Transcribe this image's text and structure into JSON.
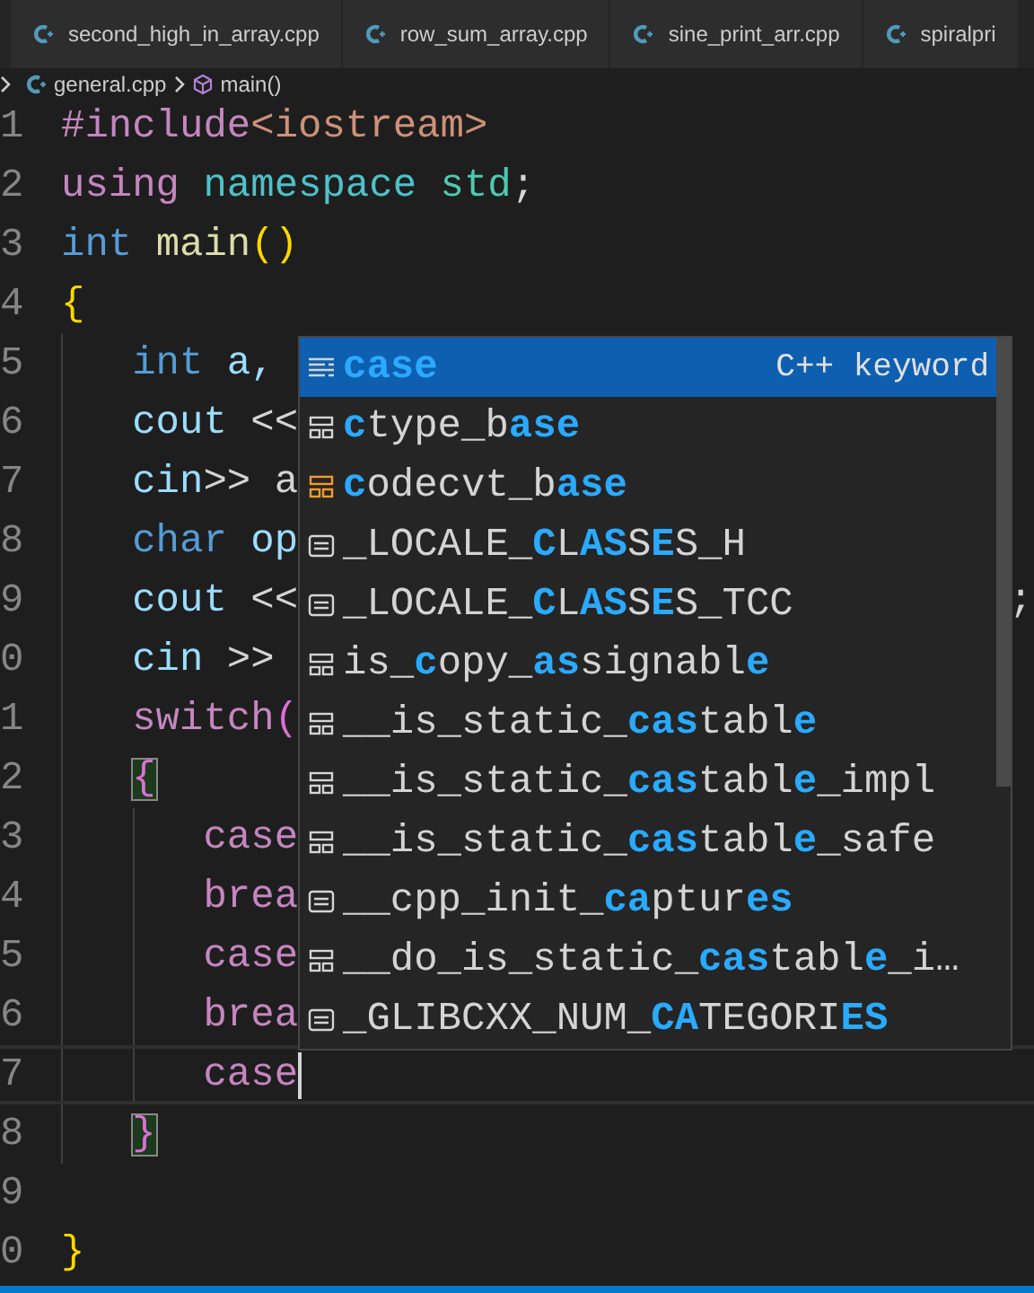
{
  "tabs": [
    {
      "label": "second_high_in_array.cpp",
      "selected": false
    },
    {
      "label": "row_sum_array.cpp",
      "selected": false
    },
    {
      "label": "sine_print_arr.cpp",
      "selected": false
    },
    {
      "label": "spiralpri",
      "selected": false
    }
  ],
  "breadcrumb": {
    "file": "general.cpp",
    "symbol": "main()"
  },
  "editor": {
    "lines": [
      {
        "number": "1",
        "tokens": [
          {
            "text": "#include",
            "color": "#c586c0"
          },
          {
            "text": "<iostream>",
            "color": "#ce9178"
          }
        ]
      },
      {
        "number": "2",
        "tokens": [
          {
            "text": "using",
            "color": "#c586c0"
          },
          {
            "text": " namespace",
            "color": "#4fc1c9"
          },
          {
            "text": " std",
            "color": "#4ec9b0"
          },
          {
            "text": ";",
            "color": "#d4d4d4"
          }
        ]
      },
      {
        "number": "3",
        "tokens": [
          {
            "text": "int",
            "color": "#569cd6"
          },
          {
            "text": " main",
            "color": "#dcdcaa"
          },
          {
            "text": "()",
            "color": "#ffd700"
          }
        ]
      },
      {
        "number": "4",
        "tokens": [
          {
            "text": "{",
            "color": "#ffd700"
          }
        ]
      },
      {
        "number": "5",
        "tokens": [
          {
            "text": "   int",
            "color": "#569cd6"
          },
          {
            "text": " a,",
            "color": "#9cdcfe"
          }
        ]
      },
      {
        "number": "6",
        "tokens": [
          {
            "text": "   cout",
            "color": "#9cdcfe"
          },
          {
            "text": " <<",
            "color": "#d4d4d4"
          }
        ]
      },
      {
        "number": "7",
        "tokens": [
          {
            "text": "   cin",
            "color": "#9cdcfe"
          },
          {
            "text": ">> a",
            "color": "#d4d4d4"
          }
        ]
      },
      {
        "number": "8",
        "tokens": [
          {
            "text": "   char",
            "color": "#569cd6"
          },
          {
            "text": " op",
            "color": "#9cdcfe"
          }
        ]
      },
      {
        "number": "9",
        "tokens": [
          {
            "text": "   cout",
            "color": "#9cdcfe"
          },
          {
            "text": " <<",
            "color": "#d4d4d4"
          },
          {
            "text": ";",
            "color": "#d4d4d4",
            "kind": "tail"
          }
        ]
      },
      {
        "number": "0",
        "tokens": [
          {
            "text": "   cin",
            "color": "#9cdcfe"
          },
          {
            "text": " >>",
            "color": "#d4d4d4"
          }
        ]
      },
      {
        "number": "1",
        "tokens": [
          {
            "text": "   switch",
            "color": "#c586c0"
          },
          {
            "text": "(",
            "color": "#da70d6"
          }
        ]
      },
      {
        "number": "2",
        "tokens": [
          {
            "text": "   {",
            "color": "#da70d6",
            "bracket_match": true
          }
        ]
      },
      {
        "number": "3",
        "tokens": [
          {
            "text": "      case",
            "color": "#c586c0"
          }
        ]
      },
      {
        "number": "4",
        "tokens": [
          {
            "text": "      brea",
            "color": "#c586c0"
          }
        ]
      },
      {
        "number": "5",
        "tokens": [
          {
            "text": "      case",
            "color": "#c586c0"
          }
        ]
      },
      {
        "number": "6",
        "tokens": [
          {
            "text": "      brea",
            "color": "#c586c0"
          }
        ]
      },
      {
        "number": "7",
        "current": true,
        "tokens": [
          {
            "text": "      case",
            "color": "#c586c0"
          }
        ]
      },
      {
        "number": "8",
        "tokens": [
          {
            "text": "   }",
            "color": "#da70d6",
            "bracket_match": true
          }
        ]
      },
      {
        "number": "9"
      },
      {
        "number": "0",
        "tokens": [
          {
            "text": "}",
            "color": "#ffd700"
          }
        ]
      }
    ]
  },
  "suggestions": [
    {
      "kind": "keyword",
      "selected": true,
      "detail": "C++ keyword",
      "label": "**case**"
    },
    {
      "kind": "struct",
      "selected": false,
      "label": "**c**type_b**ase**"
    },
    {
      "kind": "class",
      "selected": false,
      "label": "**c**odecvt_b**ase**"
    },
    {
      "kind": "macro",
      "selected": false,
      "label": "_LOCALE_**C**L**AS**S**E**S_H"
    },
    {
      "kind": "macro",
      "selected": false,
      "label": "_LOCALE_**C**L**AS**S**E**S_TCC"
    },
    {
      "kind": "struct",
      "selected": false,
      "label": "is_**c**opy_**as**signabl**e**"
    },
    {
      "kind": "struct",
      "selected": false,
      "label": "__is_static_**cas**tabl**e**"
    },
    {
      "kind": "struct",
      "selected": false,
      "label": "__is_static_**cas**tabl**e**_impl"
    },
    {
      "kind": "struct",
      "selected": false,
      "label": "__is_static_**cas**tabl**e**_safe"
    },
    {
      "kind": "macro",
      "selected": false,
      "label": "__cpp_init_**ca**ptur**es**"
    },
    {
      "kind": "struct",
      "selected": false,
      "label": "__do_is_static_**cas**tabl**e**_i…"
    },
    {
      "kind": "macro",
      "selected": false,
      "label": "_GLIBCXX_NUM_**CA**TEGORI**ES**"
    }
  ]
}
